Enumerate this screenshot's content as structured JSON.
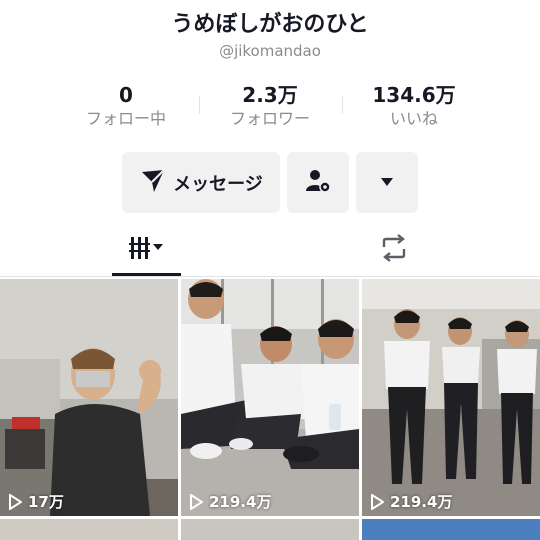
{
  "profile": {
    "display_name": "うめぼしがおのひと",
    "username": "@jikomandao"
  },
  "stats": [
    {
      "value": "0",
      "label": "フォロー中"
    },
    {
      "value": "2.3万",
      "label": "フォロワー"
    },
    {
      "value": "134.6万",
      "label": "いいね"
    }
  ],
  "actions": {
    "message_label": "メッセージ",
    "message_icon": "send-icon",
    "follow_icon": "user-settings-icon",
    "more_icon": "caret-down-icon"
  },
  "tabs": {
    "videos_icon": "grid-sort-icon",
    "reposts_icon": "repost-icon"
  },
  "videos": [
    {
      "views": "17万"
    },
    {
      "views": "219.4万"
    },
    {
      "views": "219.4万"
    }
  ],
  "colors": {
    "text": "#161823",
    "secondary": "#8a8b91",
    "button_bg": "#f1f1f2",
    "divider": "#e3e3e4"
  }
}
